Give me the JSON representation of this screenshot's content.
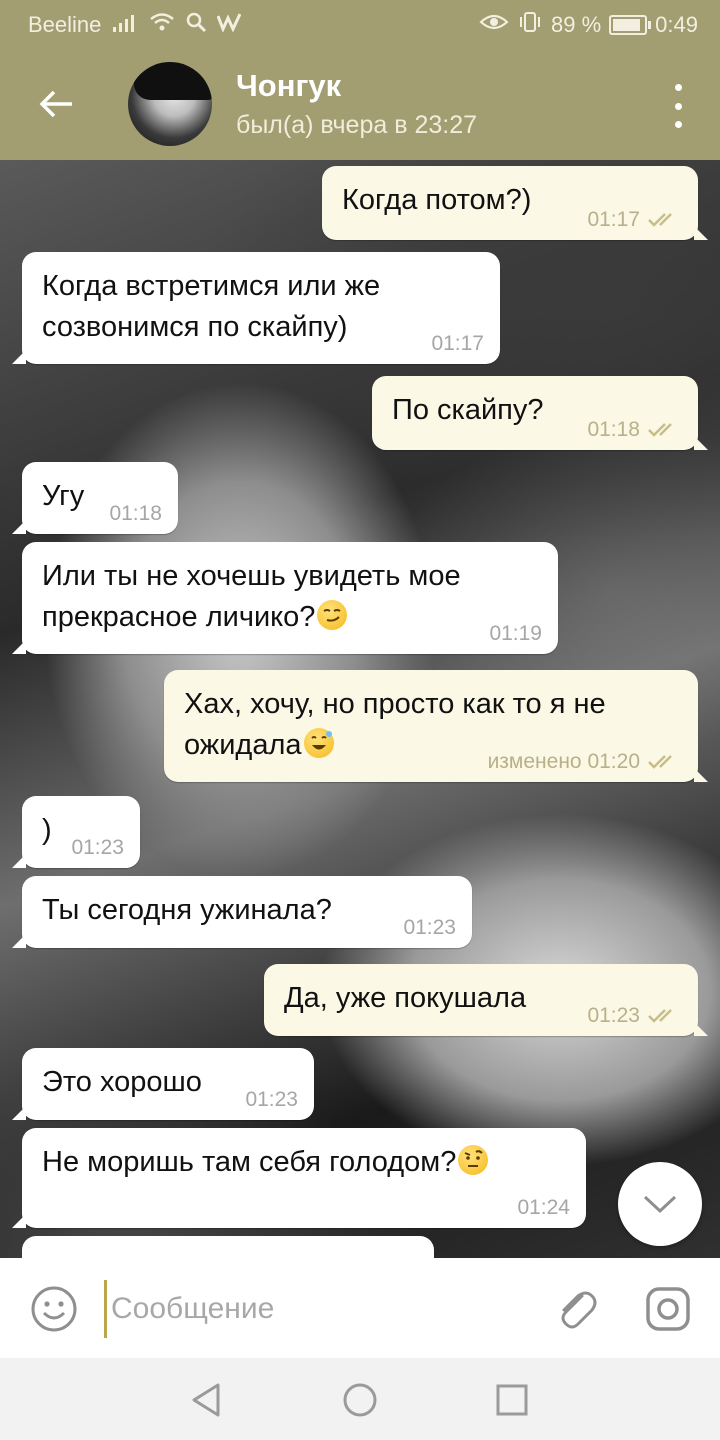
{
  "status_bar": {
    "carrier": "Beeline",
    "battery_percent": "89 %",
    "battery_level": 0.89,
    "time": "0:49"
  },
  "header": {
    "contact_name": "Чонгук",
    "contact_status": "был(а) вчера в 23:27"
  },
  "messages": [
    {
      "side": "out",
      "lines": [
        "Когда потом?)"
      ],
      "time": "01:17",
      "read": true
    },
    {
      "side": "in",
      "lines": [
        "Когда встретимся или же",
        "созвонимся по скайпу)"
      ],
      "time": "01:17"
    },
    {
      "side": "out",
      "lines": [
        "По скайпу?"
      ],
      "time": "01:18",
      "read": true
    },
    {
      "side": "in",
      "lines": [
        "Угу"
      ],
      "time": "01:18"
    },
    {
      "side": "in",
      "lines": [
        "Или ты не хочешь увидеть мое",
        "прекрасное личико?"
      ],
      "time": "01:19",
      "emoji": "smirking-face"
    },
    {
      "side": "out",
      "lines": [
        "Хах, хочу, но просто как то я не",
        "ожидала"
      ],
      "time": "изменено 01:20",
      "read": true,
      "emoji": "grinning-face-with-sweat"
    },
    {
      "side": "in",
      "lines": [
        ")"
      ],
      "time": "01:23"
    },
    {
      "side": "in",
      "lines": [
        "Ты сегодня ужинала?"
      ],
      "time": "01:23"
    },
    {
      "side": "out",
      "lines": [
        "Да, уже покушала"
      ],
      "time": "01:23",
      "read": true
    },
    {
      "side": "in",
      "lines": [
        "Это хорошо"
      ],
      "time": "01:23"
    },
    {
      "side": "in",
      "lines": [
        "Не моришь там себя голодом?"
      ],
      "time": "01:24",
      "emoji": "face-with-raised-eyebrow"
    }
  ],
  "input": {
    "placeholder": "Сообщение",
    "value": ""
  },
  "colors": {
    "header": "#a39d72",
    "outgoing_bubble": "#fbf8e6",
    "incoming_bubble": "#ffffff",
    "check_marks": "#c7bd86"
  },
  "icons": {
    "back": "arrow-left",
    "menu": "vertical-dots",
    "emoji": "smiley",
    "attach": "paperclip",
    "camera": "instagram-camera",
    "scroll_down": "chevron-down",
    "nav_back": "triangle-left",
    "nav_home": "circle",
    "nav_recent": "square"
  }
}
